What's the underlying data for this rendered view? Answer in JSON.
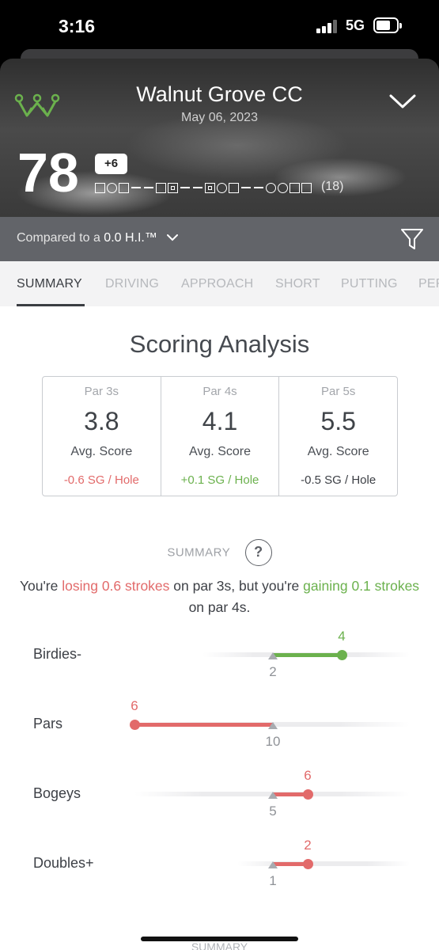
{
  "status_bar": {
    "time": "3:16",
    "network": "5G"
  },
  "header": {
    "course_name": "Walnut Grove CC",
    "date": "May 06, 2023",
    "score": "78",
    "to_par": "+6",
    "holes_played": "(18)",
    "hole_results": [
      "square",
      "circle",
      "square",
      "dash",
      "dash",
      "square",
      "dbl",
      "dash",
      "dash",
      "dbl",
      "circle",
      "square",
      "dash",
      "dash",
      "circle",
      "circle",
      "square",
      "square"
    ]
  },
  "compare": {
    "prefix": "Compared to a",
    "value": "0.0 H.I.™"
  },
  "tabs": [
    "SUMMARY",
    "DRIVING",
    "APPROACH",
    "SHORT",
    "PUTTING",
    "PERFORMANCE"
  ],
  "active_tab": "SUMMARY",
  "scoring": {
    "title": "Scoring Analysis",
    "cards": [
      {
        "par": "Par 3s",
        "avg": "3.8",
        "avg_label": "Avg. Score",
        "sg": "-0.6 SG / Hole",
        "sg_color": "#e26a6a"
      },
      {
        "par": "Par 4s",
        "avg": "4.1",
        "avg_label": "Avg. Score",
        "sg": "+0.1 SG / Hole",
        "sg_color": "#6bb14d"
      },
      {
        "par": "Par 5s",
        "avg": "5.5",
        "avg_label": "Avg. Score",
        "sg": "-0.5 SG / Hole",
        "sg_color": "#3d4046"
      }
    ]
  },
  "summary": {
    "header": "SUMMARY",
    "t1": "You're ",
    "t2": "losing 0.6 strokes",
    "t3": " on par 3s, but you're ",
    "t4": "gaining 0.1 strokes",
    "t5": " on par 4s."
  },
  "distribution": [
    {
      "label": "Birdies-",
      "value": "4",
      "baseline": "2",
      "color": "#6bb14d"
    },
    {
      "label": "Pars",
      "value": "6",
      "baseline": "10",
      "color": "#e26a6a"
    },
    {
      "label": "Bogeys",
      "value": "6",
      "baseline": "5",
      "color": "#e26a6a"
    },
    {
      "label": "Doubles+",
      "value": "2",
      "baseline": "1",
      "color": "#e26a6a"
    }
  ],
  "next_section_header": "SUMMARY",
  "colors": {
    "negative": "#e26a6a",
    "positive": "#6bb14d",
    "logo": "#6bb14d"
  }
}
